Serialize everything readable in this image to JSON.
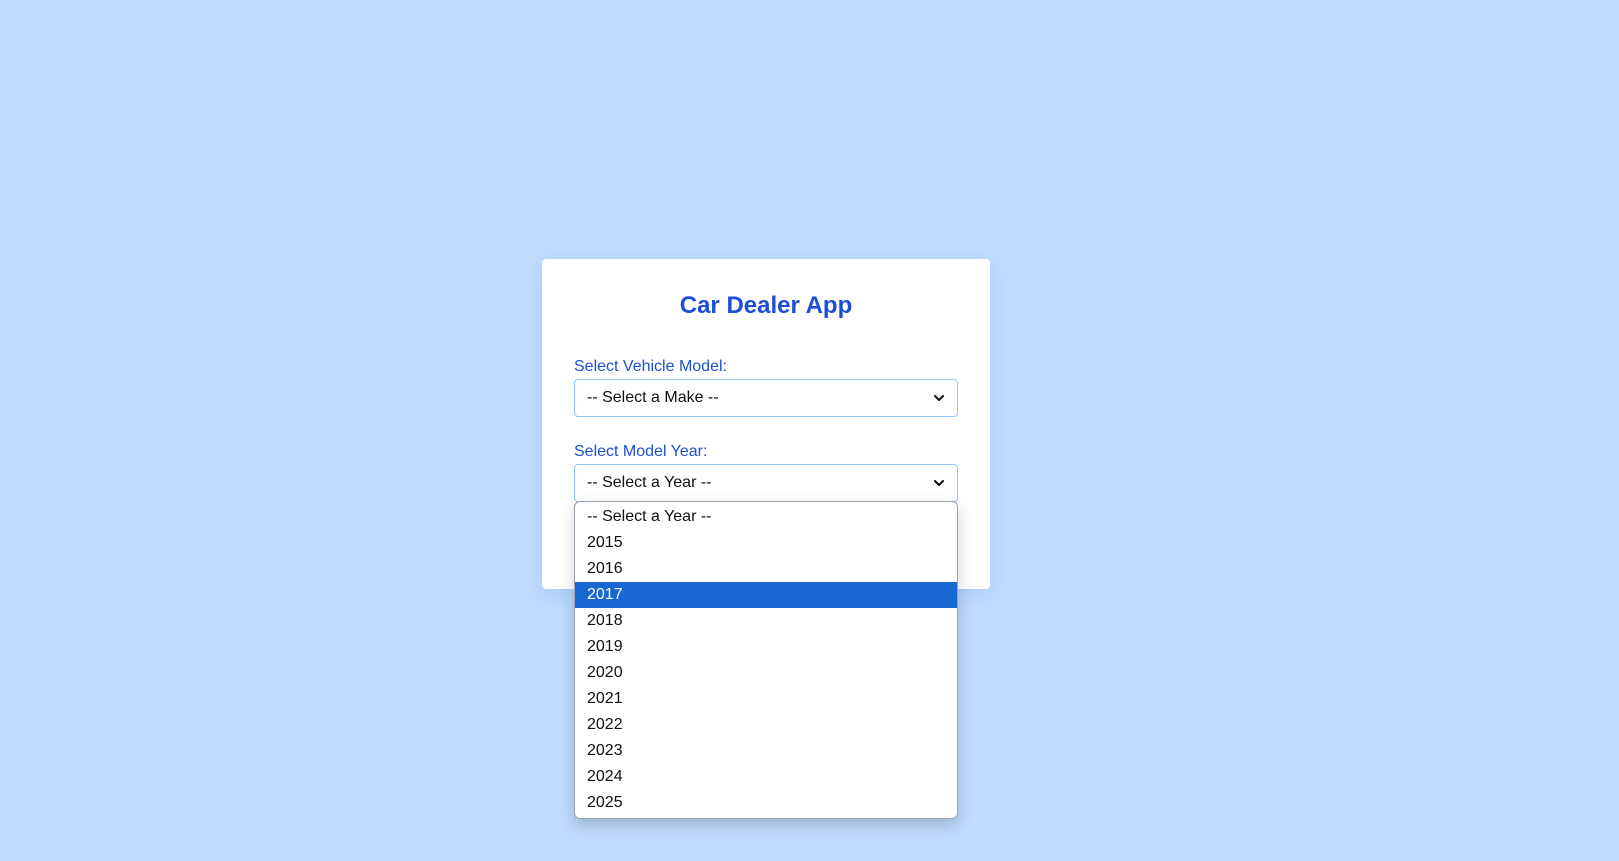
{
  "app": {
    "title": "Car Dealer App"
  },
  "form": {
    "make_label": "Select Vehicle Model:",
    "make_value": "-- Select a Make --",
    "year_label": "Select Model Year:",
    "year_value": "-- Select a Year --"
  },
  "year_dropdown": {
    "highlighted": "2017",
    "options": [
      "-- Select a Year --",
      "2015",
      "2016",
      "2017",
      "2018",
      "2019",
      "2020",
      "2021",
      "2022",
      "2023",
      "2024",
      "2025"
    ]
  },
  "colors": {
    "background": "#bfdbfe",
    "accent": "#1d4ed8",
    "highlight": "#1967d2"
  },
  "icons": {
    "select_chevron": "chevron-down-icon"
  }
}
